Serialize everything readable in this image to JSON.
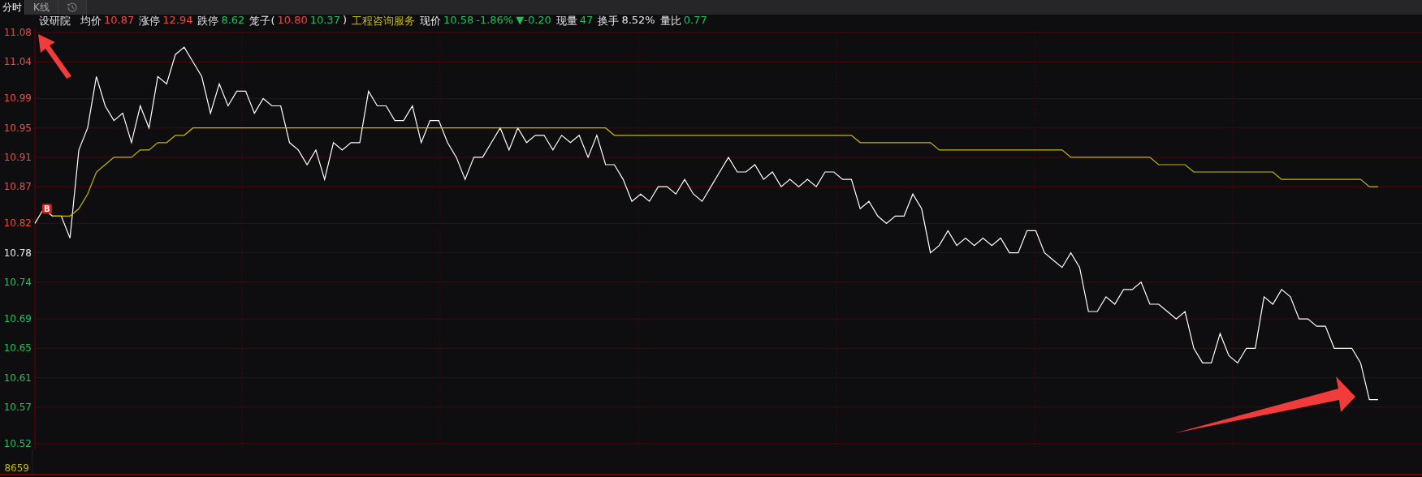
{
  "tabs": [
    {
      "label": "分时",
      "selected": true
    },
    {
      "label": "K线",
      "selected": false
    },
    {
      "kind": "icon",
      "selected": false
    }
  ],
  "stock_name": "设研院",
  "stats": [
    {
      "label": "均价",
      "values": [
        {
          "text": "10.87",
          "color": "#f04a43"
        }
      ]
    },
    {
      "label": "涨停",
      "values": [
        {
          "text": "12.94",
          "color": "#f04a43"
        }
      ]
    },
    {
      "label": "跌停",
      "values": [
        {
          "text": "8.62",
          "color": "#1fc25a"
        }
      ]
    },
    {
      "label": "笼子(",
      "values": [
        {
          "text": "10.80",
          "color": "#f04a43"
        },
        {
          "text": "10.37",
          "color": "#1fc25a"
        }
      ],
      "suffix": ")"
    },
    {
      "values": [
        {
          "text": "工程咨询服务",
          "color": "#c9b800"
        }
      ]
    },
    {
      "label": "现价",
      "values": [
        {
          "text": "10.58",
          "color": "#1fc25a"
        },
        {
          "text": "-1.86%",
          "color": "#1fc25a"
        },
        {
          "text": "▼-0.20",
          "color": "#1fc25a"
        }
      ]
    },
    {
      "label": "现量",
      "values": [
        {
          "text": "47",
          "color": "#1fc25a"
        }
      ]
    },
    {
      "label": "换手",
      "values": [
        {
          "text": "8.52%",
          "color": "#e6e6e6"
        }
      ]
    },
    {
      "label": "量比",
      "values": [
        {
          "text": "0.77",
          "color": "#1fc25a"
        }
      ]
    }
  ],
  "chart_data": {
    "type": "line",
    "ylim": [
      10.52,
      11.08
    ],
    "yticks": [
      {
        "value": 11.08,
        "label": "11.08"
      },
      {
        "value": 11.04,
        "label": "11.04"
      },
      {
        "value": 10.99,
        "label": "10.99"
      },
      {
        "value": 10.95,
        "label": "10.95"
      },
      {
        "value": 10.91,
        "label": "10.91"
      },
      {
        "value": 10.87,
        "label": "10.87"
      },
      {
        "value": 10.82,
        "label": "10.82"
      },
      {
        "value": 10.78,
        "label": "10.78"
      },
      {
        "value": 10.74,
        "label": "10.74"
      },
      {
        "value": 10.69,
        "label": "10.69"
      },
      {
        "value": 10.65,
        "label": "10.65"
      },
      {
        "value": 10.61,
        "label": "10.61"
      },
      {
        "value": 10.57,
        "label": "10.57"
      },
      {
        "value": 10.52,
        "label": "10.52"
      }
    ],
    "grid": true,
    "series": [
      {
        "color": "#ffffff",
        "values": [
          10.82,
          10.84,
          10.83,
          10.83,
          10.8,
          10.92,
          10.95,
          11.02,
          10.98,
          10.96,
          10.97,
          10.93,
          10.98,
          10.95,
          11.02,
          11.01,
          11.05,
          11.06,
          11.04,
          11.02,
          10.97,
          11.01,
          10.98,
          11.0,
          11.0,
          10.97,
          10.99,
          10.98,
          10.98,
          10.93,
          10.92,
          10.9,
          10.92,
          10.88,
          10.93,
          10.92,
          10.93,
          10.93,
          11.0,
          10.98,
          10.98,
          10.96,
          10.96,
          10.98,
          10.93,
          10.96,
          10.96,
          10.93,
          10.91,
          10.88,
          10.91,
          10.91,
          10.93,
          10.95,
          10.92,
          10.95,
          10.93,
          10.94,
          10.94,
          10.92,
          10.94,
          10.93,
          10.94,
          10.91,
          10.94,
          10.9,
          10.9,
          10.88,
          10.85,
          10.86,
          10.85,
          10.87,
          10.87,
          10.86,
          10.88,
          10.86,
          10.85,
          10.87,
          10.89,
          10.91,
          10.89,
          10.89,
          10.9,
          10.88,
          10.89,
          10.87,
          10.88,
          10.87,
          10.88,
          10.87,
          10.89,
          10.89,
          10.88,
          10.88,
          10.84,
          10.85,
          10.83,
          10.82,
          10.83,
          10.83,
          10.86,
          10.84,
          10.78,
          10.79,
          10.81,
          10.79,
          10.8,
          10.79,
          10.8,
          10.79,
          10.8,
          10.78,
          10.78,
          10.81,
          10.81,
          10.78,
          10.77,
          10.76,
          10.78,
          10.76,
          10.7,
          10.7,
          10.72,
          10.71,
          10.73,
          10.73,
          10.74,
          10.71,
          10.71,
          10.7,
          10.69,
          10.7,
          10.65,
          10.63,
          10.63,
          10.67,
          10.64,
          10.63,
          10.65,
          10.65,
          10.72,
          10.71,
          10.73,
          10.72,
          10.69,
          10.69,
          10.68,
          10.68,
          10.65,
          10.65,
          10.65,
          10.63,
          10.58,
          10.58
        ]
      },
      {
        "color": "#c9b800",
        "values": [
          null,
          null,
          10.83,
          10.83,
          10.83,
          10.84,
          10.86,
          10.89,
          10.9,
          10.91,
          10.91,
          10.91,
          10.92,
          10.92,
          10.93,
          10.93,
          10.94,
          10.94,
          10.95,
          10.95,
          10.95,
          10.95,
          10.95,
          10.95,
          10.95,
          10.95,
          10.95,
          10.95,
          10.95,
          10.95,
          10.95,
          10.95,
          10.95,
          10.95,
          10.95,
          10.95,
          10.95,
          10.95,
          10.95,
          10.95,
          10.95,
          10.95,
          10.95,
          10.95,
          10.95,
          10.95,
          10.95,
          10.95,
          10.95,
          10.95,
          10.95,
          10.95,
          10.95,
          10.95,
          10.95,
          10.95,
          10.95,
          10.95,
          10.95,
          10.95,
          10.95,
          10.95,
          10.95,
          10.95,
          10.95,
          10.95,
          10.94,
          10.94,
          10.94,
          10.94,
          10.94,
          10.94,
          10.94,
          10.94,
          10.94,
          10.94,
          10.94,
          10.94,
          10.94,
          10.94,
          10.94,
          10.94,
          10.94,
          10.94,
          10.94,
          10.94,
          10.94,
          10.94,
          10.94,
          10.94,
          10.94,
          10.94,
          10.94,
          10.94,
          10.93,
          10.93,
          10.93,
          10.93,
          10.93,
          10.93,
          10.93,
          10.93,
          10.93,
          10.92,
          10.92,
          10.92,
          10.92,
          10.92,
          10.92,
          10.92,
          10.92,
          10.92,
          10.92,
          10.92,
          10.92,
          10.92,
          10.92,
          10.92,
          10.91,
          10.91,
          10.91,
          10.91,
          10.91,
          10.91,
          10.91,
          10.91,
          10.91,
          10.91,
          10.9,
          10.9,
          10.9,
          10.9,
          10.89,
          10.89,
          10.89,
          10.89,
          10.89,
          10.89,
          10.89,
          10.89,
          10.89,
          10.89,
          10.88,
          10.88,
          10.88,
          10.88,
          10.88,
          10.88,
          10.88,
          10.88,
          10.88,
          10.88,
          10.87,
          10.87
        ]
      }
    ]
  },
  "axis_label_styles": [
    {
      "color": "#f04a43"
    },
    {
      "color": "#f04a43"
    },
    {
      "color": "#f04a43"
    },
    {
      "color": "#f04a43"
    },
    {
      "color": "#f04a43"
    },
    {
      "color": "#f04a43"
    },
    {
      "color": "#f04a43"
    },
    {
      "color": "#e6e6e6"
    },
    {
      "color": "#1fc25a"
    },
    {
      "color": "#1fc25a"
    },
    {
      "color": "#1fc25a"
    },
    {
      "color": "#1fc25a"
    },
    {
      "color": "#1fc25a"
    },
    {
      "color": "#1fc25a"
    }
  ],
  "marker": {
    "label": "B"
  },
  "volume_label": "8659"
}
